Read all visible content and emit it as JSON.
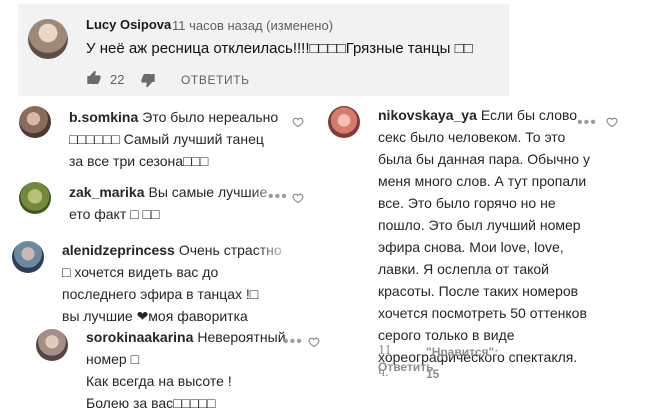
{
  "youtube_comment": {
    "author": "Lucy Osipova",
    "time": "11 часов назад (изменено)",
    "text": "У неё аж ресница отклеилась!!!!□□□□Грязные танцы □□",
    "like_count": "22",
    "reply_label": "ОТВЕТИТЬ",
    "like_icon": "thumbs-up-icon",
    "dislike_icon": "thumbs-down-icon"
  },
  "instagram_comments": [
    {
      "username": "b.somkina",
      "lines": [
        "Это было нереально",
        "□□□□□□ Самый лучший танец",
        "за все три сезона□□□"
      ]
    },
    {
      "username": "zak_marika",
      "lines": [
        "Вы самые лучшие",
        "ето факт □ □□"
      ]
    },
    {
      "username": "alenidzeprincess",
      "lines": [
        "Очень страстно",
        "□ хочется видеть вас до",
        "последнего эфира в танцах !□",
        "вы лучшие ❤моя фаворитка"
      ]
    },
    {
      "username": "sorokinaakarina",
      "lines": [
        "Невероятный",
        "номер □",
        "Как всегда на высоте !",
        "Болею за вас□□□□□"
      ]
    }
  ],
  "long_comment": {
    "username": "nikovskaya_ya",
    "lines": [
      "Если бы слово",
      "секс было человеком. То это",
      "была бы данная пара. Обычно у",
      "меня много слов. А тут пропали",
      "все. Это было горячо но не",
      "пошло. Это был лучший номер",
      "эфира снова. Мои love, love,",
      "лавки. Я ослепла от такой",
      "красоты. После таких номеров",
      "хочется посмотреть 50 оттенков",
      "серого только в виде",
      "хореографического спектакля."
    ],
    "time": "11 ч.",
    "likes": "\"Нравится\": 15",
    "reply_label": "Ответить"
  },
  "colors": {
    "youtube_bg": "#f2f2f2",
    "text": "#262626",
    "muted": "#8e8e8e"
  },
  "icons": {
    "more": "more-dots-icon",
    "like": "heart-outline-icon"
  }
}
